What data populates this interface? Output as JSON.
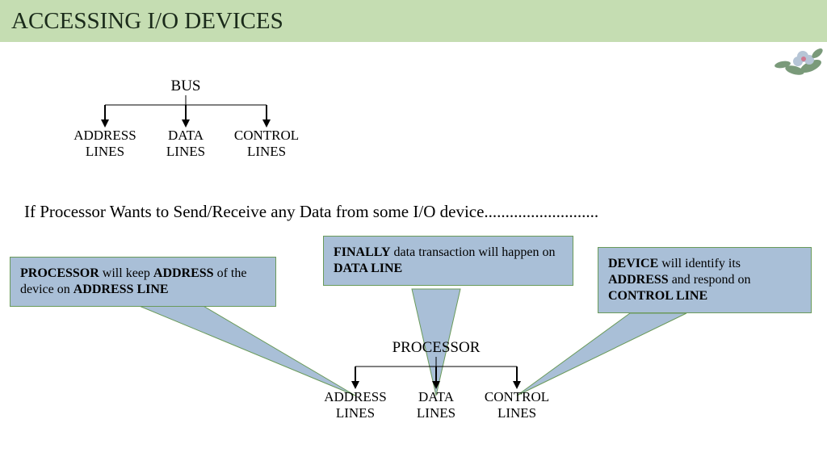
{
  "header": {
    "title": "ACCESSING I/O DEVICES"
  },
  "tree1": {
    "root": "BUS",
    "children": [
      "ADDRESS LINES",
      "DATA LINES",
      "CONTROL LINES"
    ]
  },
  "paragraph": "If Processor Wants to Send/Receive any Data from some I/O device...........................",
  "callouts": {
    "left": {
      "b1": "PROCESSOR",
      "t1": " will keep ",
      "b2": "ADDRESS",
      "t2": " of the device  on ",
      "b3": "ADDRESS LINE"
    },
    "middle": {
      "b1": "FINALLY",
      "t1": " data transaction will happen on ",
      "b2": "DATA LINE"
    },
    "right": {
      "b1": "DEVICE",
      "t1": " will identify its ",
      "b2": "ADDRESS",
      "t2": " and respond on ",
      "b3": "CONTROL LINE"
    }
  },
  "tree2": {
    "root": "PROCESSOR",
    "children": [
      "ADDRESS LINES",
      "DATA LINES",
      "CONTROL LINES"
    ]
  },
  "colors": {
    "header_bg": "#c5ddb2",
    "callout_bg": "#a9bfd7",
    "callout_border": "#6a9a5a"
  }
}
